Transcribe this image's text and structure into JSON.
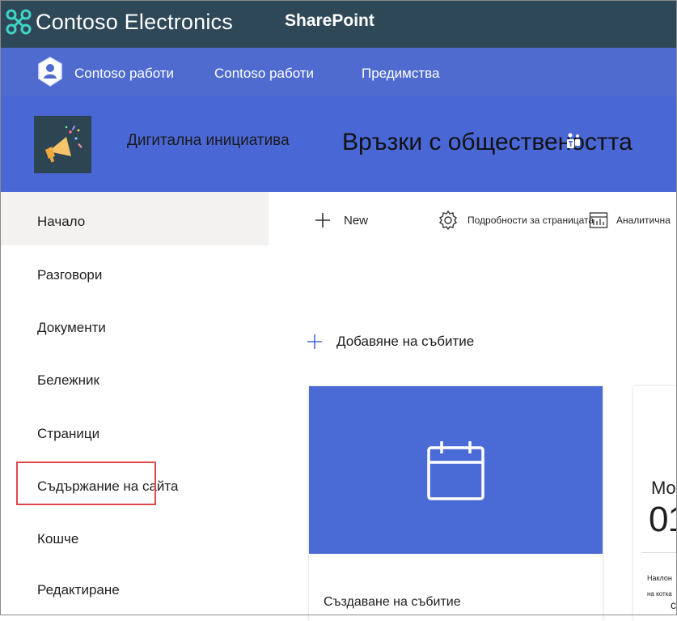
{
  "suite": {
    "org_name": "Contoso Electronics",
    "app_name": "SharePoint"
  },
  "hub": {
    "logo_icon": "hub-person-shield-icon",
    "links": [
      {
        "label": "Contoso работи"
      },
      {
        "label": "Contoso работи"
      },
      {
        "label": "Предимства"
      }
    ]
  },
  "site": {
    "title": "Дигитална инициатива",
    "subtitle": "Връзки с обществеността",
    "logo_icon": "megaphone-icon",
    "teams_icon": "teams-icon"
  },
  "nav": {
    "items": [
      {
        "label": "Начало"
      },
      {
        "label": "Разговори"
      },
      {
        "label": "Документи"
      },
      {
        "label": "Бележник"
      },
      {
        "label": "Страници"
      },
      {
        "label": "Съдържание на сайта"
      },
      {
        "label": "Кошче"
      },
      {
        "label": "Редактиране"
      }
    ],
    "active_index": 0,
    "highlighted_index": 5
  },
  "commandbar": {
    "new_label": "New",
    "page_details_label": "Подробности за страницата",
    "analytics_label": "Аналитична"
  },
  "events": {
    "add_label": "Добавяне на събитие",
    "create_card_label": "Създаване на събитие",
    "partial_card": {
      "month": "Mo",
      "day": "01",
      "line1": "Наклон",
      "line2": "на котка",
      "line3": "с"
    }
  },
  "colors": {
    "suite_bar": "#2f4858",
    "hub_nav": "#4f6bcf",
    "site_header": "#4a67d6",
    "card_banner": "#4a6bd6",
    "highlight": "#e0474c"
  }
}
